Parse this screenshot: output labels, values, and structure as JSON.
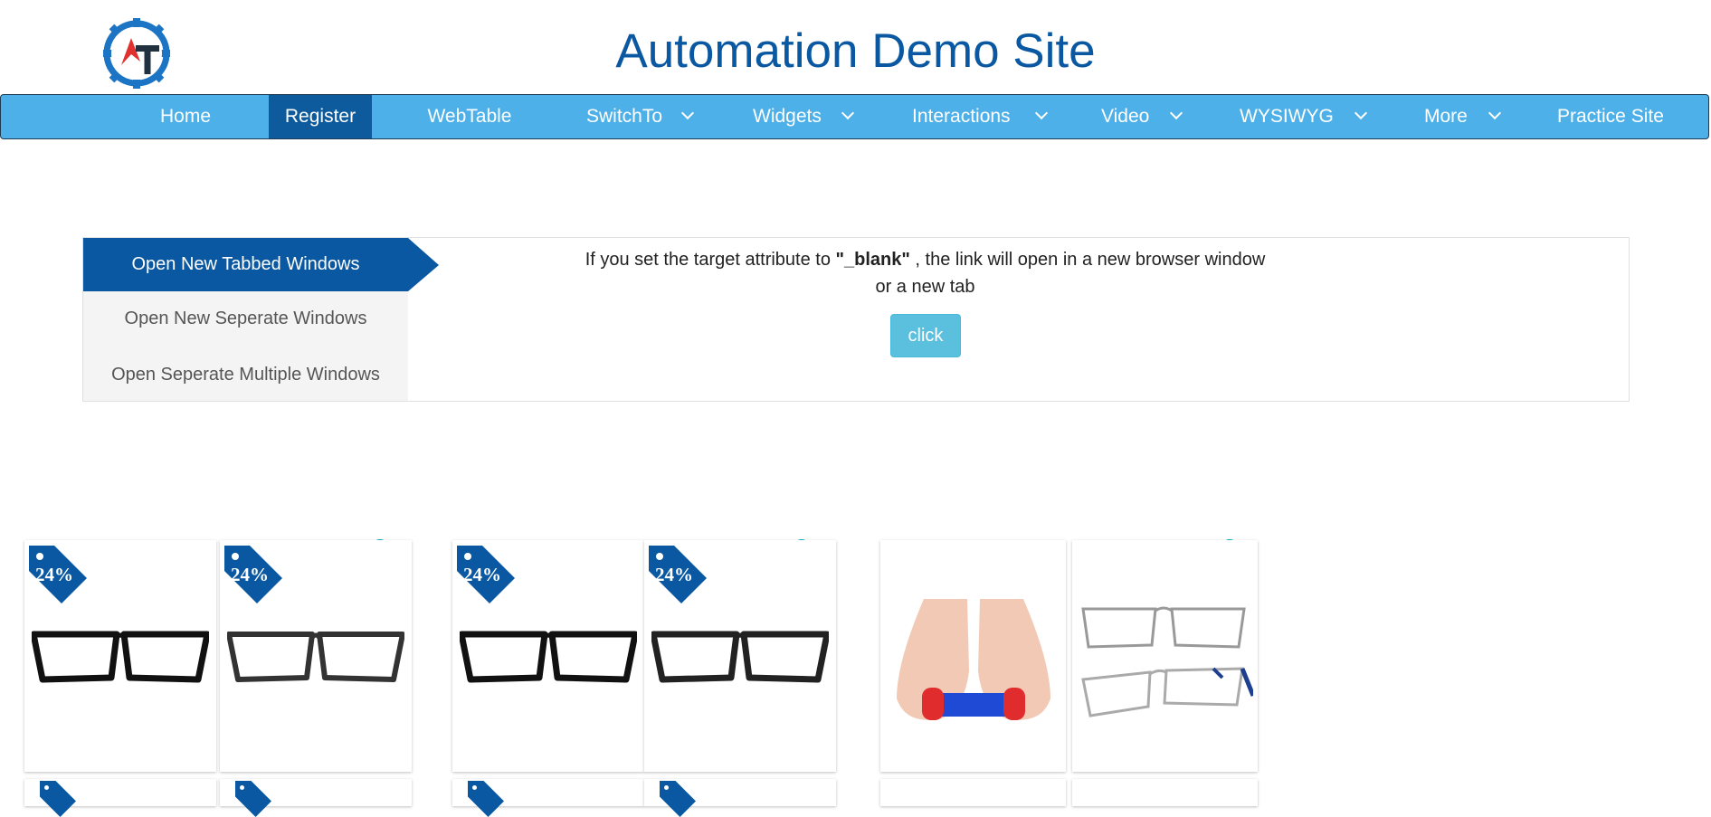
{
  "header": {
    "title": "Automation Demo Site"
  },
  "nav": {
    "items": [
      {
        "label": "Home"
      },
      {
        "label": "Register"
      },
      {
        "label": "WebTable"
      },
      {
        "label": "SwitchTo"
      },
      {
        "label": "Widgets"
      },
      {
        "label": "Interactions"
      },
      {
        "label": "Video"
      },
      {
        "label": "WYSIWYG"
      },
      {
        "label": "More"
      },
      {
        "label": "Practice Site"
      }
    ],
    "active": "Register"
  },
  "windows": {
    "tabs": [
      {
        "label": "Open New Tabbed Windows"
      },
      {
        "label": "Open New Seperate Windows"
      },
      {
        "label": "Open Seperate Multiple Windows"
      }
    ],
    "active_tab": "Open New Tabbed Windows",
    "description": {
      "before": "If you set the target attribute to ",
      "strong": "\"_blank\"",
      "after": " , the link will open in a new browser window",
      "line2": "or a new tab"
    },
    "button_label": "click"
  },
  "ads": {
    "badge": "24%",
    "colors": {
      "tag": "#0a58a1",
      "controls": "#00aecd"
    }
  },
  "colors": {
    "brand": "#0a58a1",
    "navbar": "#4eb0e8",
    "nav_active": "#0d5b9c",
    "button": "#5bc0de"
  }
}
